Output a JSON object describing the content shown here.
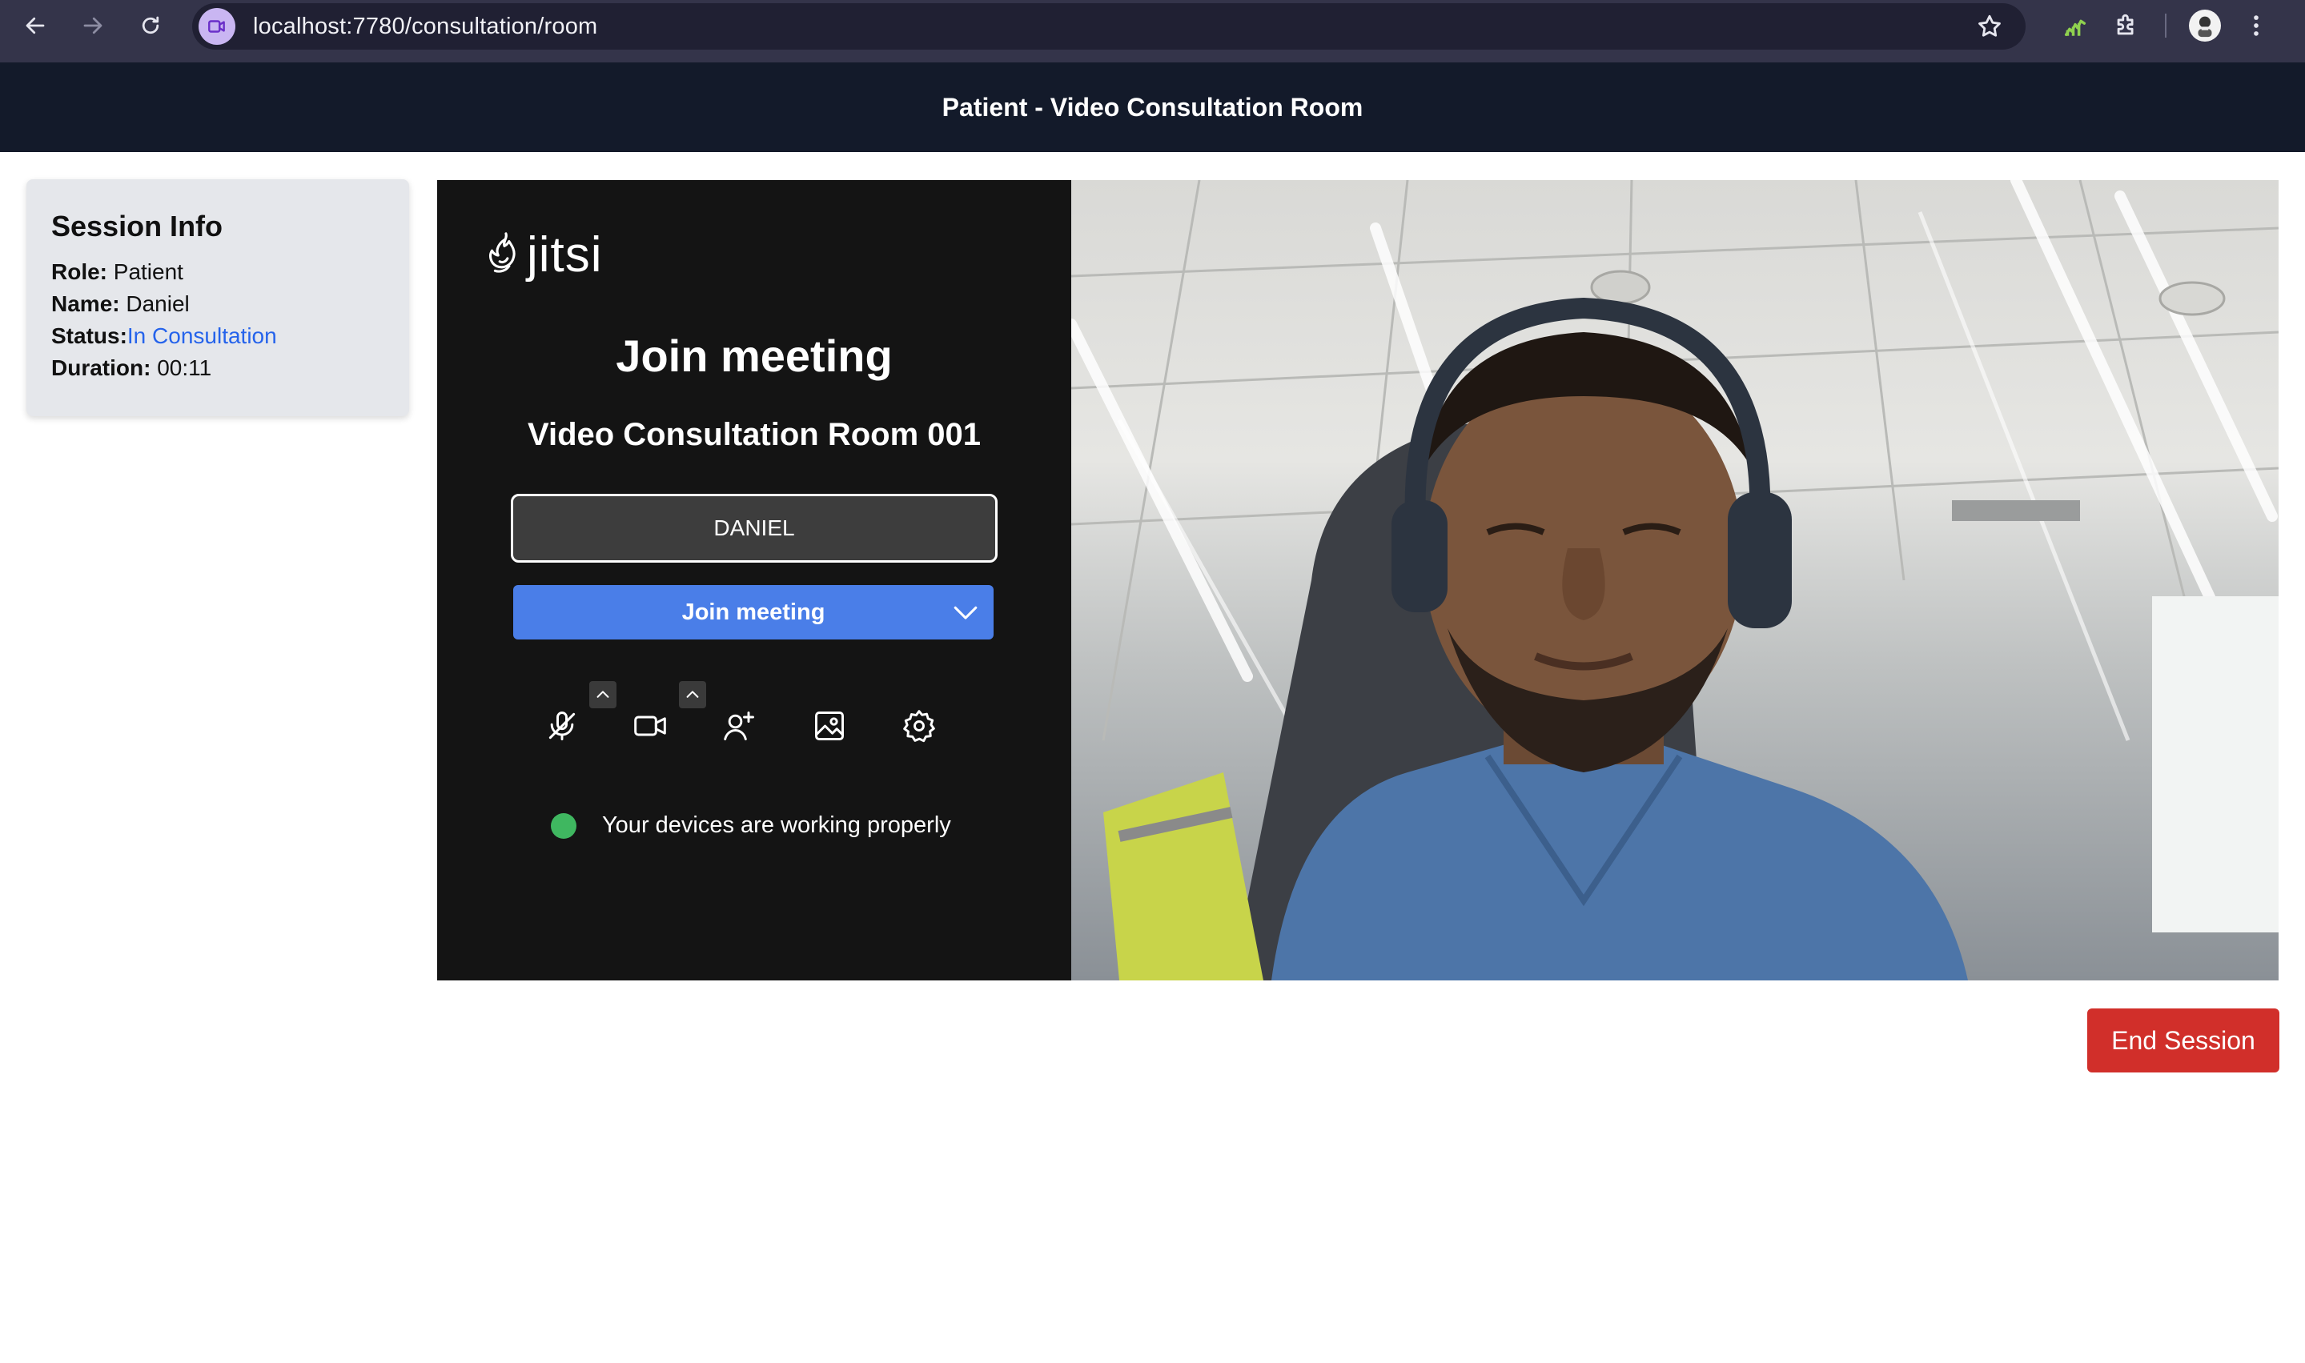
{
  "browser": {
    "url": "localhost:7780/consultation/room"
  },
  "header": {
    "title": "Patient - Video Consultation Room"
  },
  "session_info": {
    "title": "Session Info",
    "role_label": "Role:",
    "role_value": "Patient",
    "name_label": "Name:",
    "name_value": "Daniel",
    "status_label": "Status:",
    "status_value": "In Consultation",
    "duration_label": "Duration:",
    "duration_value": "00:11"
  },
  "jitsi": {
    "logo_text": "jitsi",
    "heading": "Join meeting",
    "room_name": "Video Consultation Room 001",
    "display_name_value": "DANIEL",
    "join_button_label": "Join meeting",
    "device_status": "Your devices are working properly",
    "toolbar_icons": [
      "microphone-muted-icon",
      "camera-icon",
      "invite-person-icon",
      "background-image-icon",
      "settings-icon"
    ]
  },
  "actions": {
    "end_session_label": "End Session"
  },
  "colors": {
    "header_bg": "#131a2a",
    "status_link": "#2563eb",
    "join_button": "#4a7ee8",
    "end_session": "#d12f2a",
    "device_ok": "#3fb760"
  }
}
